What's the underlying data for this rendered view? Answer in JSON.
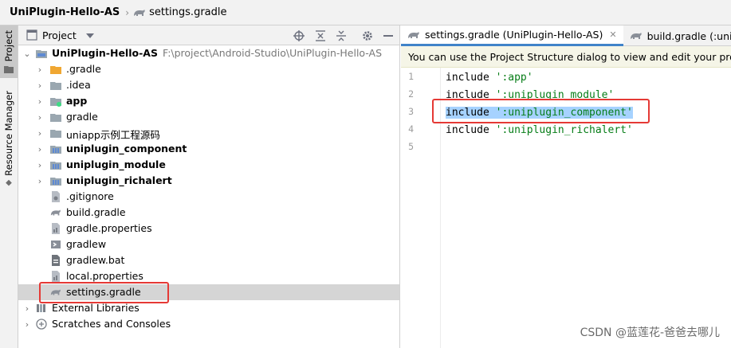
{
  "breadcrumb": {
    "project": "UniPlugin-Hello-AS",
    "file": "settings.gradle"
  },
  "stripe": {
    "project_label": "Project",
    "resource_label": "Resource Manager"
  },
  "project_panel": {
    "title": "Project",
    "root": {
      "name": "UniPlugin-Hello-AS",
      "path": "F:\\project\\Android-Studio\\UniPlugin-Hello-AS"
    },
    "items": [
      {
        "label": ".gradle"
      },
      {
        "label": ".idea"
      },
      {
        "label": "app"
      },
      {
        "label": "gradle"
      },
      {
        "label": "uniapp示例工程源码"
      },
      {
        "label": "uniplugin_component"
      },
      {
        "label": "uniplugin_module"
      },
      {
        "label": "uniplugin_richalert"
      },
      {
        "label": ".gitignore"
      },
      {
        "label": "build.gradle"
      },
      {
        "label": "gradle.properties"
      },
      {
        "label": "gradlew"
      },
      {
        "label": "gradlew.bat"
      },
      {
        "label": "local.properties"
      },
      {
        "label": "settings.gradle"
      }
    ],
    "external_libraries": "External Libraries",
    "scratches": "Scratches and Consoles"
  },
  "editor": {
    "tabs": [
      {
        "label": "settings.gradle (UniPlugin-Hello-AS)"
      },
      {
        "label": "build.gradle (:uniplugi"
      }
    ],
    "notice": "You can use the Project Structure dialog to view and edit your project",
    "lines": [
      {
        "num": "1",
        "kw": "include",
        "str": "':app'"
      },
      {
        "num": "2",
        "kw": "include",
        "str": "':uniplugin_module'"
      },
      {
        "num": "3",
        "kw": "include",
        "str": "':uniplugin_component'"
      },
      {
        "num": "4",
        "kw": "include",
        "str": "':uniplugin_richalert'"
      },
      {
        "num": "5",
        "kw": "",
        "str": ""
      }
    ]
  },
  "watermark": "CSDN @蓝莲花-爸爸去哪儿",
  "colors": {
    "accent": "#4083c9",
    "highlight": "#a6d2ff",
    "annotation": "#e53935",
    "string": "#067d17"
  }
}
